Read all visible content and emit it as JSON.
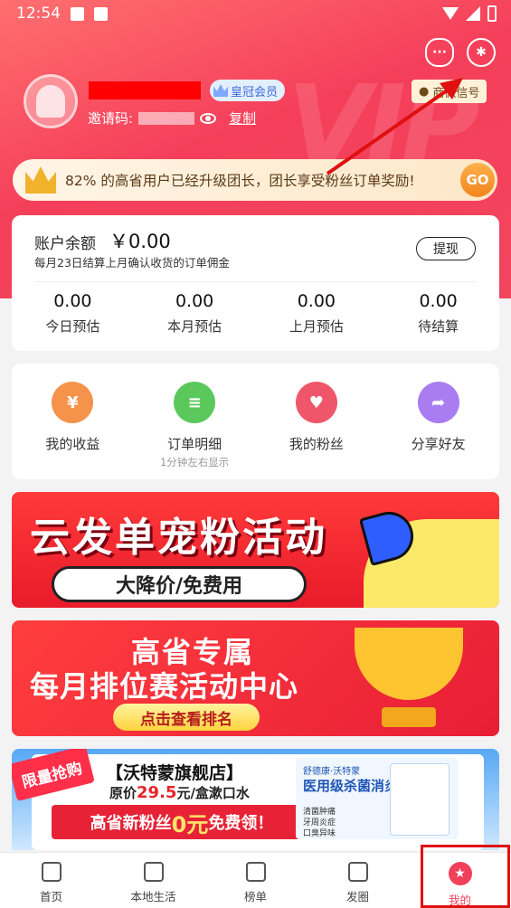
{
  "status_bar": {
    "time": "12:54"
  },
  "header": {
    "wechat_label": "商微信号",
    "vip_label": "皇冠会员",
    "invite_label": "邀请码:",
    "copy_label": "复制",
    "watermark": "VIP"
  },
  "promo": {
    "text": "82% 的高省用户已经升级团长，团长享受粉丝订单奖励!",
    "go": "GO"
  },
  "balance": {
    "label": "账户余额",
    "amount": "￥0.00",
    "note": "每月23日结算上月确认收货的订单佣金",
    "withdraw": "提现",
    "stats": [
      {
        "value": "0.00",
        "label": "今日预估"
      },
      {
        "value": "0.00",
        "label": "本月预估"
      },
      {
        "value": "0.00",
        "label": "上月预估"
      },
      {
        "value": "0.00",
        "label": "待结算"
      }
    ]
  },
  "menu": [
    {
      "label": "我的收益",
      "sub": "",
      "color": "#f5934b",
      "icon": "yen-icon",
      "glyph": "¥"
    },
    {
      "label": "订单明细",
      "sub": "1分钟左右显示",
      "color": "#5bc85b",
      "icon": "clipboard-icon",
      "glyph": "≡"
    },
    {
      "label": "我的粉丝",
      "sub": "",
      "color": "#f0566a",
      "icon": "user-heart-icon",
      "glyph": "♥"
    },
    {
      "label": "分享好友",
      "sub": "",
      "color": "#a97cf2",
      "icon": "share-icon",
      "glyph": "➦"
    }
  ],
  "banners": {
    "b1_title": "云发单宠粉活动",
    "b1_pill": "大降价/免费用",
    "b2_line1": "高省专属",
    "b2_line2": "每月排位赛活动中心",
    "b2_button": "点击查看排名",
    "b3_tag": "限量抢购",
    "b3_store": "【沃特蒙旗舰店】",
    "b3_price_prefix": "原价",
    "b3_price_value": "29.5",
    "b3_price_suffix": "元/盒漱口水",
    "b3_free_prefix": "高省新粉丝",
    "b3_free_zero": "0元",
    "b3_free_suffix": "免费领！",
    "b3_product_brand": "舒德康·沃特蒙",
    "b3_product_title": "医用级杀菌消炎",
    "b3_product_points": [
      "清菌肿痛",
      "牙周炎症",
      "口臭异味"
    ]
  },
  "tabbar": [
    {
      "label": "首页",
      "icon": "home-icon"
    },
    {
      "label": "本地生活",
      "icon": "fork-knife-icon"
    },
    {
      "label": "榜单",
      "icon": "podium-icon"
    },
    {
      "label": "发圈",
      "icon": "grid-icon"
    },
    {
      "label": "我的",
      "icon": "profile-icon",
      "active": true
    }
  ],
  "colors": {
    "accent": "#f0405a",
    "annotation": "#e01010"
  }
}
